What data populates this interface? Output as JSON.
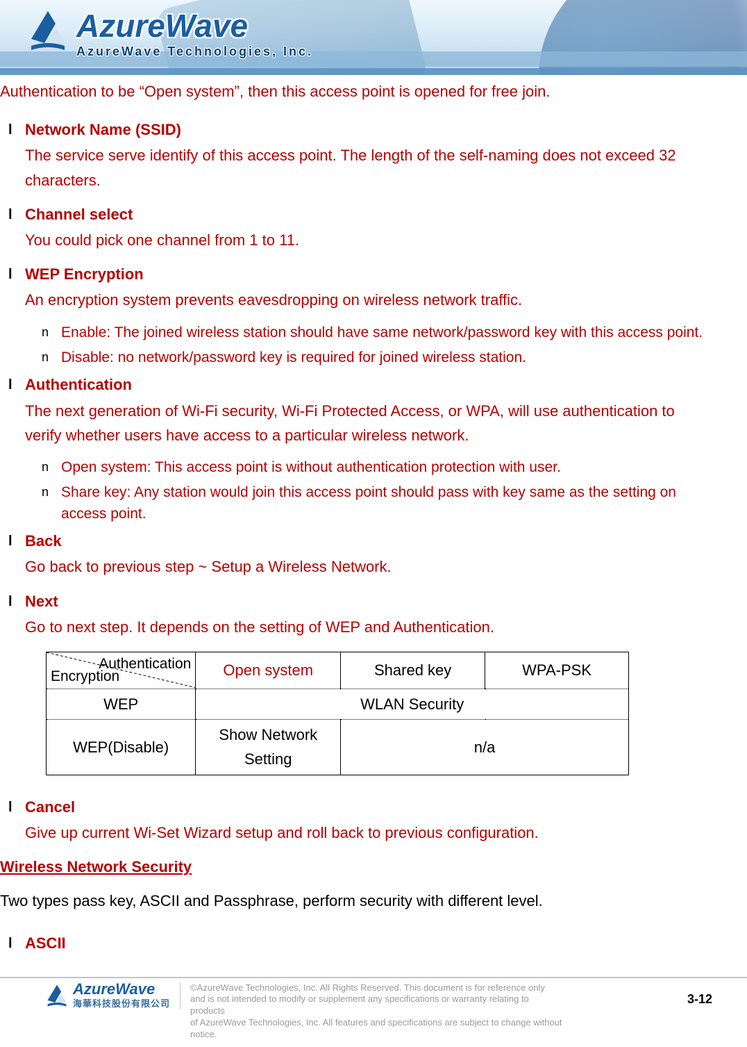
{
  "banner": {
    "logo_main": "AzureWave",
    "logo_sub": "AzureWave  Technologies,    Inc."
  },
  "intro": "Authentication to be “Open system”, then this access point is opened for free join.",
  "items": [
    {
      "heading": "Network Name (SSID)",
      "desc": "The service serve identify of this access point. The length of the self-naming does not exceed 32 characters."
    },
    {
      "heading": "Channel select",
      "desc": "You could pick one channel from 1 to 11."
    },
    {
      "heading": "WEP Encryption",
      "desc": "An encryption system prevents eavesdropping on wireless network traffic.",
      "sub": [
        "Enable: The joined wireless station should have same network/password key with this access point.",
        "Disable: no network/password key is required for joined wireless station."
      ]
    },
    {
      "heading": "Authentication",
      "desc": "The next generation of Wi-Fi security, Wi-Fi Protected Access, or WPA, will use authentication to verify whether users have access to a particular wireless network.",
      "sub": [
        "Open system: This access point is without authentication protection with user.",
        "Share key: Any station would join this access point should pass with key same as the setting on access point."
      ]
    },
    {
      "heading": "Back",
      "desc": "Go back to previous step ~ Setup a Wireless Network."
    },
    {
      "heading": "Next",
      "desc": "Go to next step. It depends on the setting of WEP and Authentication."
    }
  ],
  "table": {
    "diag_top": "Authentication",
    "diag_bottom": "Encryption",
    "cols": [
      "Open system",
      "Shared key",
      "WPA-PSK"
    ],
    "rows": [
      {
        "label": "WEP",
        "span_value": "WLAN Security"
      },
      {
        "label": "WEP(Disable)",
        "c1": "Show Network Setting",
        "c2": "n/a"
      }
    ]
  },
  "cancel": {
    "heading": "Cancel",
    "desc": "Give up current Wi-Set Wizard setup and roll back to previous configuration."
  },
  "section_title": "Wireless Network Security",
  "section_text": "Two types pass key, ASCII and Passphrase, perform security with different level.",
  "ascii_heading": "ASCII",
  "footer": {
    "logo_main": "AzureWave",
    "logo_sub": "海華科技股份有限公司",
    "disclaimer_l1": "©AzureWave Technologies, Inc. All Rights Reserved. This document is for reference only",
    "disclaimer_l2": "and is not intended to modify or supplement any specifications or  warranty relating to products",
    "disclaimer_l3": "of AzureWave Technologies, Inc.  All features and specifications are subject to change without notice.",
    "page_num": "3-12"
  }
}
